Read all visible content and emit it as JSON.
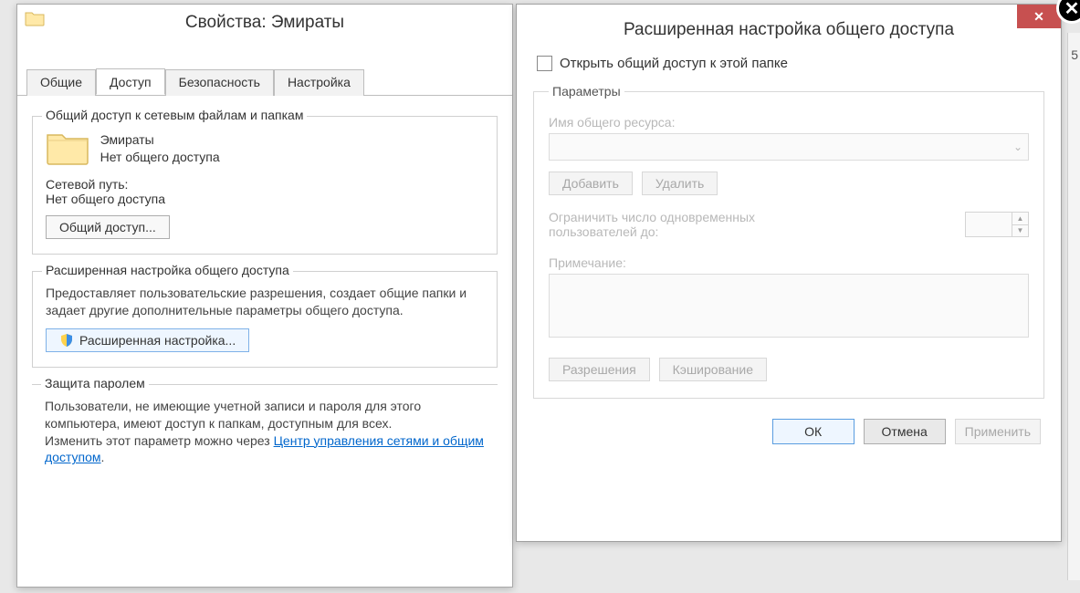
{
  "left": {
    "title": "Свойства: Эмираты",
    "tabs": {
      "general": "Общие",
      "sharing": "Доступ",
      "security": "Безопасность",
      "customize": "Настройка"
    },
    "group_net": {
      "legend": "Общий доступ к сетевым файлам и папкам",
      "folder_name": "Эмираты",
      "no_share": "Нет общего доступа",
      "net_path_label": "Сетевой путь:",
      "net_path_value": "Нет общего доступа",
      "share_btn": "Общий доступ..."
    },
    "group_adv": {
      "legend": "Расширенная настройка общего доступа",
      "desc": "Предоставляет пользовательские разрешения, создает общие папки и задает другие дополнительные параметры общего доступа.",
      "adv_btn": "Расширенная настройка..."
    },
    "group_pwd": {
      "legend": "Защита паролем",
      "desc1": "Пользователи, не имеющие учетной записи и пароля для этого компьютера, имеют доступ к папкам, доступным для всех.",
      "desc2a": "Изменить этот параметр можно через ",
      "link": "Центр управления сетями и общим доступом",
      "desc2b": "."
    }
  },
  "right": {
    "title": "Расширенная настройка общего доступа",
    "share_check": "Открыть общий доступ к этой папке",
    "params": {
      "legend": "Параметры",
      "name_label": "Имя общего ресурса:",
      "add": "Добавить",
      "remove": "Удалить",
      "limit_label": "Ограничить число одновременных пользователей до:",
      "note_label": "Примечание:",
      "perm": "Разрешения",
      "cache": "Кэширование"
    },
    "buttons": {
      "ok": "ОК",
      "cancel": "Отмена",
      "apply": "Применить"
    }
  },
  "side_char": "5"
}
